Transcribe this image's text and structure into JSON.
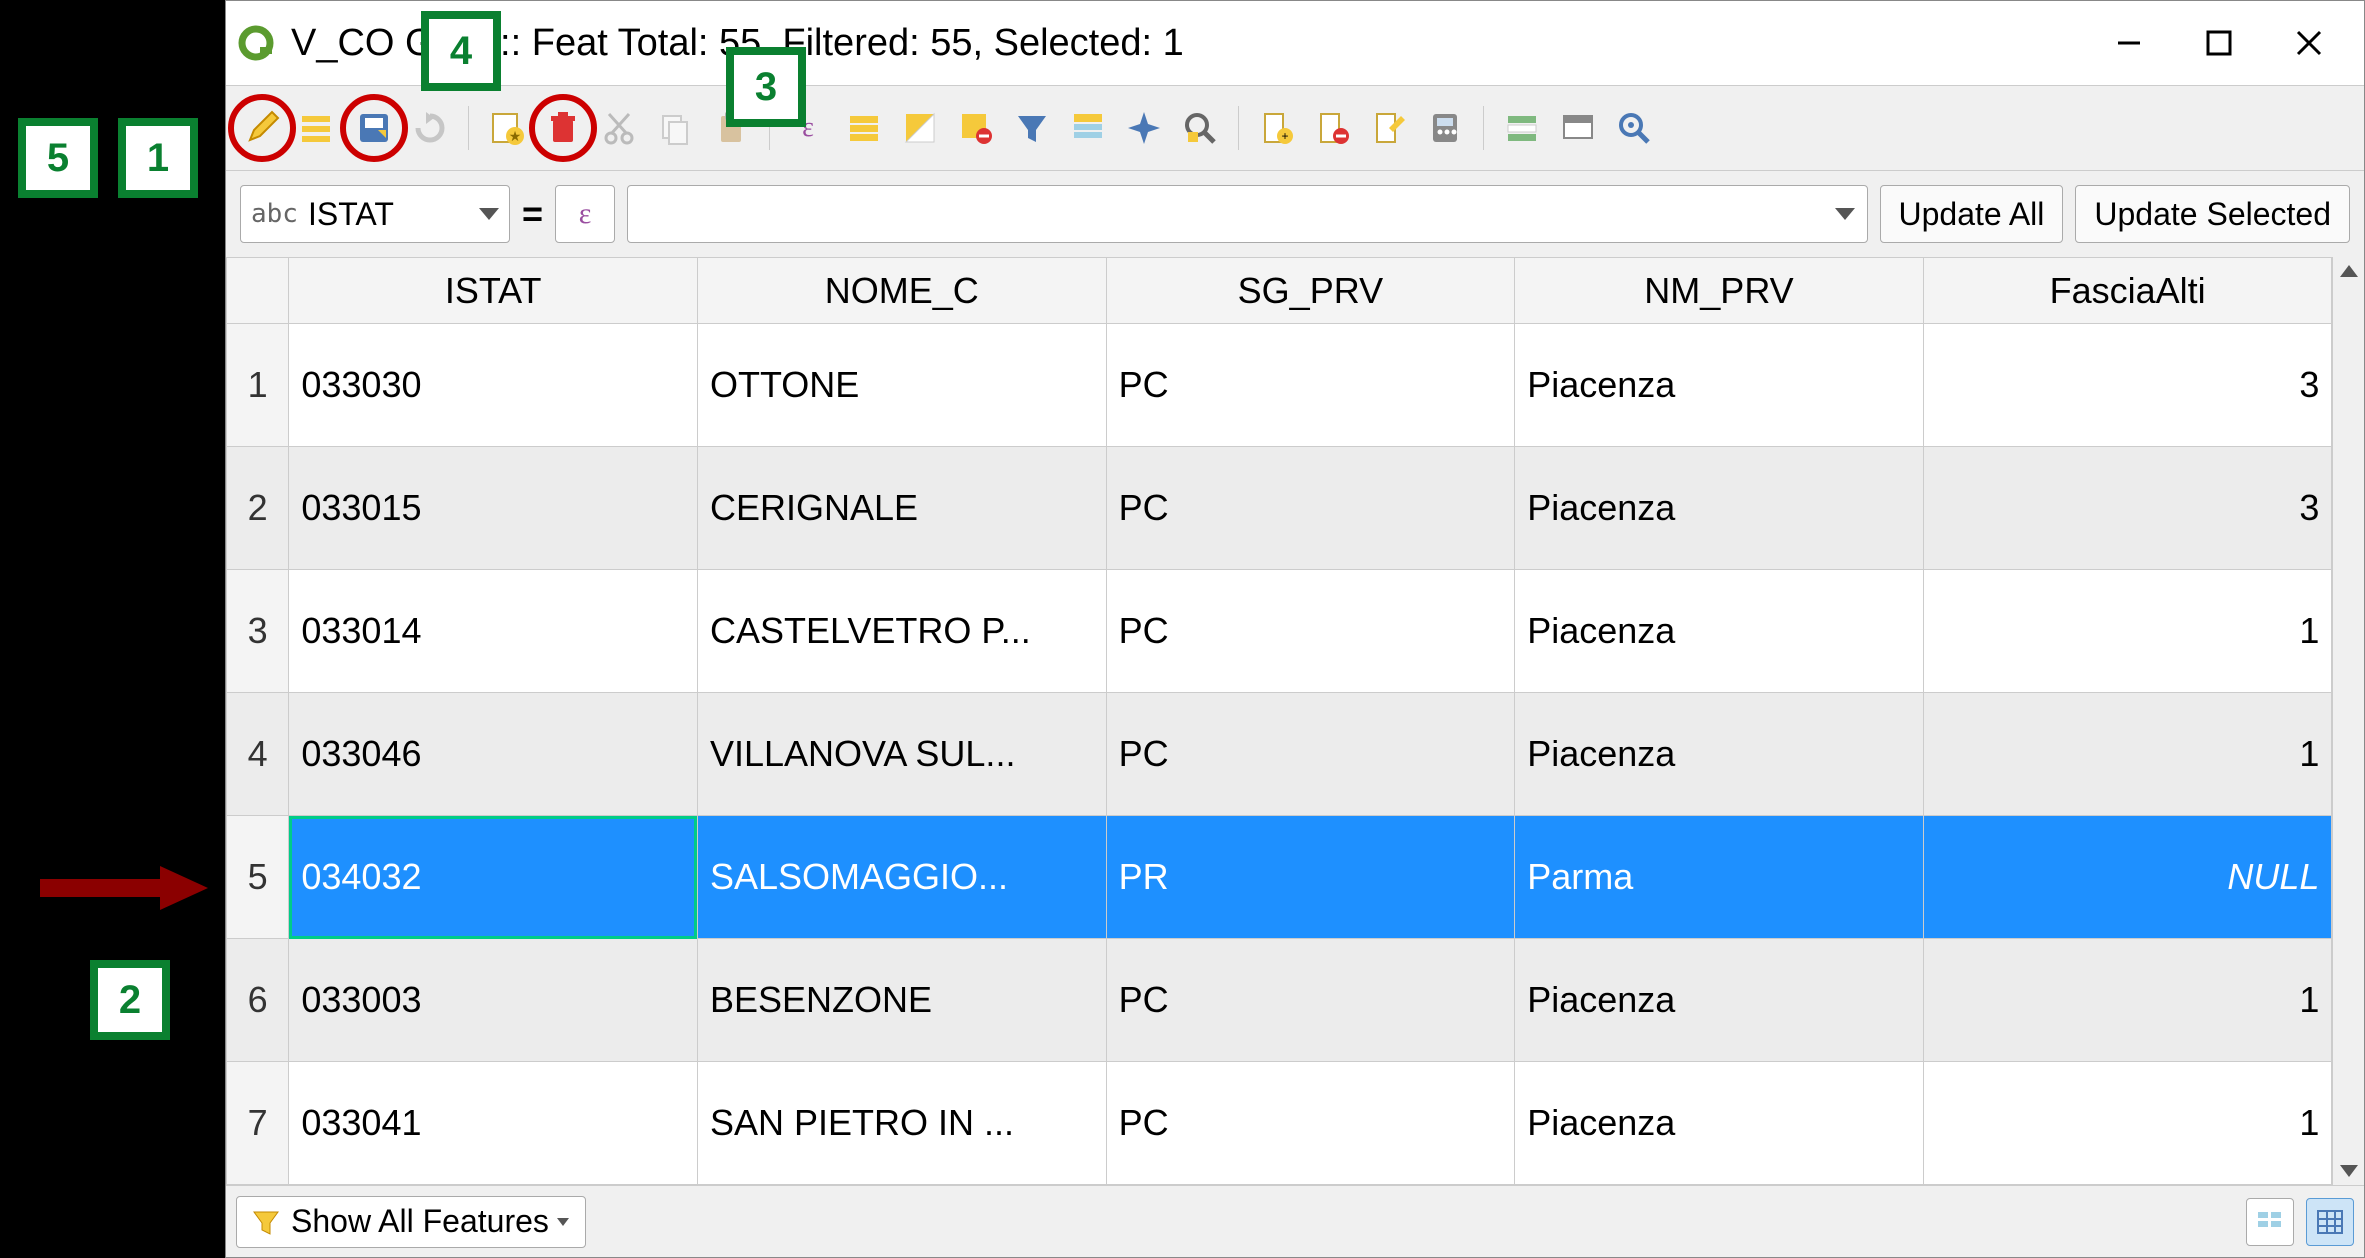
{
  "window": {
    "title": "V_CO       GPG :: Feat         Total: 55, Filtered: 55, Selected: 1"
  },
  "fieldbar": {
    "abc": "abc",
    "selected_field": "ISTAT",
    "eq": "=",
    "update_all": "Update All",
    "update_selected": "Update Selected"
  },
  "table": {
    "columns": [
      "ISTAT",
      "NOME_C",
      "SG_PRV",
      "NM_PRV",
      "FasciaAlti"
    ],
    "rows": [
      {
        "n": "1",
        "ISTAT": "033030",
        "NOME_C": "OTTONE",
        "SG_PRV": "PC",
        "NM_PRV": "Piacenza",
        "FasciaAlti": "3",
        "selected": false
      },
      {
        "n": "2",
        "ISTAT": "033015",
        "NOME_C": "CERIGNALE",
        "SG_PRV": "PC",
        "NM_PRV": "Piacenza",
        "FasciaAlti": "3",
        "selected": false
      },
      {
        "n": "3",
        "ISTAT": "033014",
        "NOME_C": "CASTELVETRO P...",
        "SG_PRV": "PC",
        "NM_PRV": "Piacenza",
        "FasciaAlti": "1",
        "selected": false
      },
      {
        "n": "4",
        "ISTAT": "033046",
        "NOME_C": "VILLANOVA SUL...",
        "SG_PRV": "PC",
        "NM_PRV": "Piacenza",
        "FasciaAlti": "1",
        "selected": false
      },
      {
        "n": "5",
        "ISTAT": "034032",
        "NOME_C": "SALSOMAGGIO...",
        "SG_PRV": "PR",
        "NM_PRV": "Parma",
        "FasciaAlti": "NULL",
        "selected": true
      },
      {
        "n": "6",
        "ISTAT": "033003",
        "NOME_C": "BESENZONE",
        "SG_PRV": "PC",
        "NM_PRV": "Piacenza",
        "FasciaAlti": "1",
        "selected": false
      },
      {
        "n": "7",
        "ISTAT": "033041",
        "NOME_C": "SAN PIETRO IN ...",
        "SG_PRV": "PC",
        "NM_PRV": "Piacenza",
        "FasciaAlti": "1",
        "selected": false
      }
    ]
  },
  "statusbar": {
    "show_all": "Show All Features"
  },
  "annotations": {
    "a1": "1",
    "a2": "2",
    "a3": "3",
    "a4": "4",
    "a5": "5"
  },
  "toolbar_icons": [
    "edit-pencil-icon",
    "multiedit-icon",
    "save-edits-icon",
    "reload-icon",
    "sep",
    "add-feature-icon",
    "delete-feature-icon",
    "cut-icon",
    "copy-icon",
    "paste-icon",
    "sep",
    "expression-select-icon",
    "select-all-icon",
    "invert-selection-icon",
    "deselect-icon",
    "filter-selection-icon",
    "move-top-icon",
    "pan-to-icon",
    "zoom-to-icon",
    "sep",
    "new-column-icon",
    "delete-column-icon",
    "rename-column-icon",
    "field-calculator-icon",
    "sep",
    "conditional-format-icon",
    "dock-icon",
    "actions-icon"
  ]
}
